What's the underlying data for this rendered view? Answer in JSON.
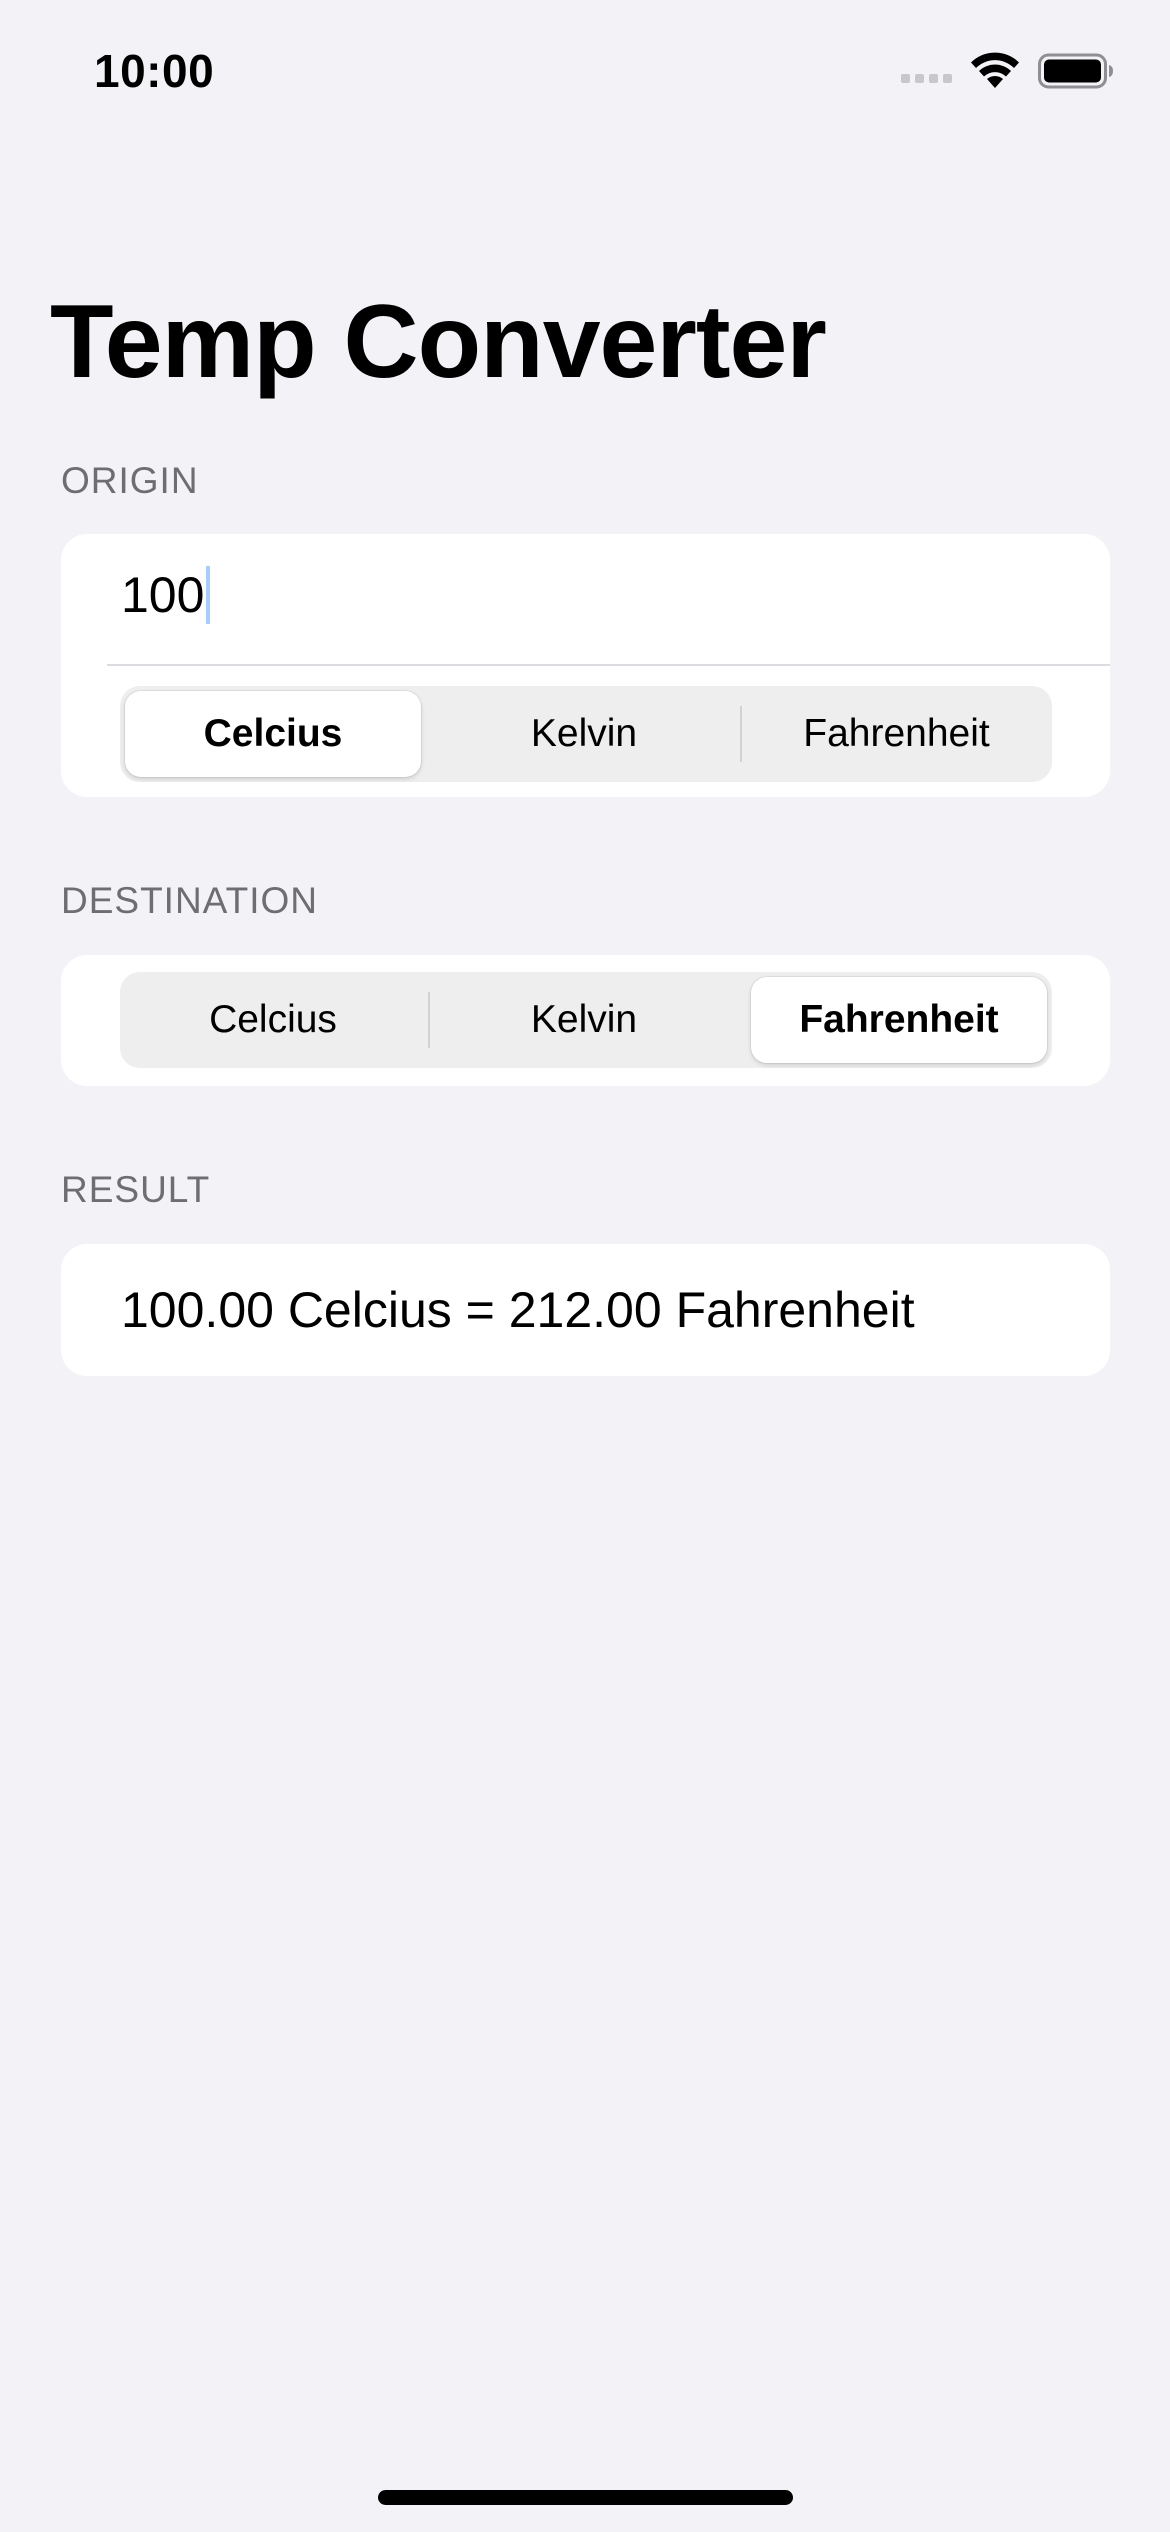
{
  "status_bar": {
    "time": "10:00",
    "icons": [
      "cellular-signal-icon",
      "wifi-icon",
      "battery-icon"
    ]
  },
  "nav": {
    "title": "Temp Converter"
  },
  "origin": {
    "header": "ORIGIN",
    "input_value": "100",
    "units": [
      "Celcius",
      "Kelvin",
      "Fahrenheit"
    ],
    "selected": "Celcius"
  },
  "destination": {
    "header": "DESTINATION",
    "units": [
      "Celcius",
      "Kelvin",
      "Fahrenheit"
    ],
    "selected": "Fahrenheit"
  },
  "result": {
    "header": "RESULT",
    "text": "100.00 Celcius = 212.00 Fahrenheit"
  },
  "colors": {
    "background": "#f2f2f7",
    "card": "#ffffff",
    "segment_track": "#eeeeef",
    "section_header": "#6d6d72",
    "caret": "#a9cdf8"
  }
}
